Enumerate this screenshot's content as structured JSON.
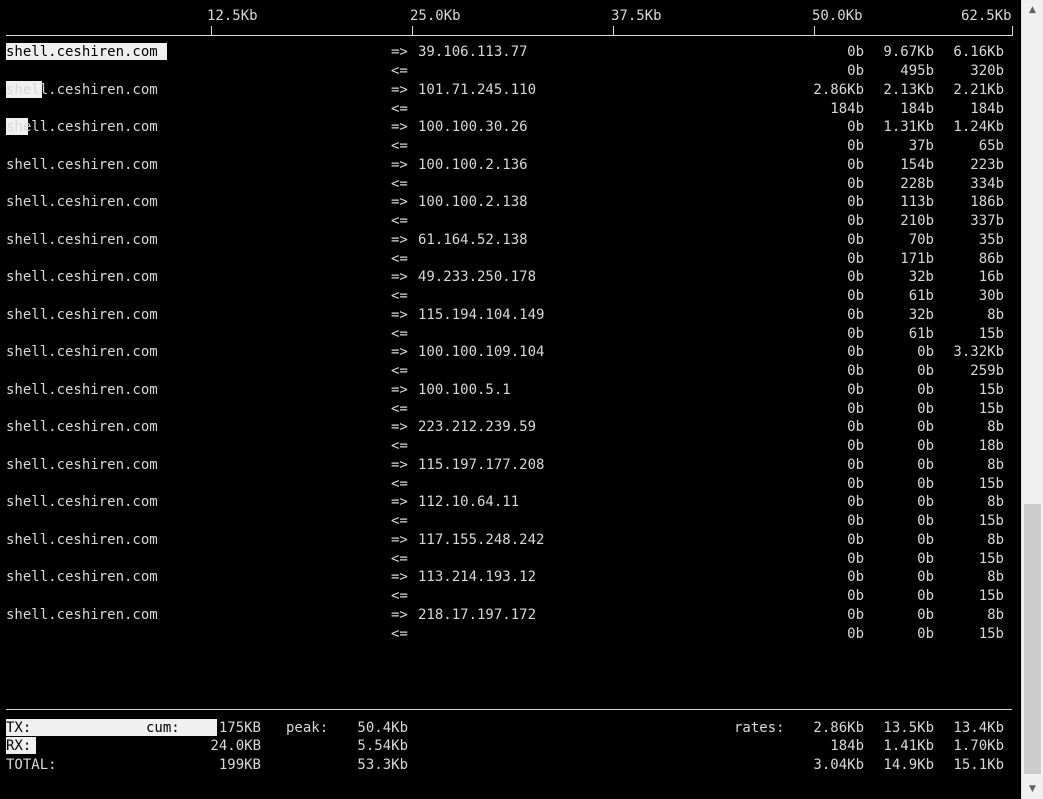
{
  "scale": {
    "labels": [
      "12.5Kb",
      "25.0Kb",
      "37.5Kb",
      "50.0Kb",
      "62.5Kb"
    ]
  },
  "connections": [
    {
      "host": "shell.ceshiren.com",
      "arrow_out": "=>",
      "arrow_in": "<=",
      "remote": "39.106.113.77",
      "out": [
        "0b",
        "9.67Kb",
        "6.16Kb"
      ],
      "in": [
        "0b",
        "495b",
        "320b"
      ],
      "bar_percent": 16
    },
    {
      "host": "shell.ceshiren.com",
      "arrow_out": "=>",
      "arrow_in": "<=",
      "remote": "101.71.245.110",
      "out": [
        "2.86Kb",
        "2.13Kb",
        "2.21Kb"
      ],
      "in": [
        "184b",
        "184b",
        "184b"
      ],
      "bar_percent": 3.6
    },
    {
      "host": "shell.ceshiren.com",
      "arrow_out": "=>",
      "arrow_in": "<=",
      "remote": "100.100.30.26",
      "out": [
        "0b",
        "1.31Kb",
        "1.24Kb"
      ],
      "in": [
        "0b",
        "37b",
        "65b"
      ],
      "bar_percent": 2.2
    },
    {
      "host": "shell.ceshiren.com",
      "arrow_out": "=>",
      "arrow_in": "<=",
      "remote": "100.100.2.136",
      "out": [
        "0b",
        "154b",
        "223b"
      ],
      "in": [
        "0b",
        "228b",
        "334b"
      ],
      "bar_percent": 0
    },
    {
      "host": "shell.ceshiren.com",
      "arrow_out": "=>",
      "arrow_in": "<=",
      "remote": "100.100.2.138",
      "out": [
        "0b",
        "113b",
        "186b"
      ],
      "in": [
        "0b",
        "210b",
        "337b"
      ],
      "bar_percent": 0
    },
    {
      "host": "shell.ceshiren.com",
      "arrow_out": "=>",
      "arrow_in": "<=",
      "remote": "61.164.52.138",
      "out": [
        "0b",
        "70b",
        "35b"
      ],
      "in": [
        "0b",
        "171b",
        "86b"
      ],
      "bar_percent": 0
    },
    {
      "host": "shell.ceshiren.com",
      "arrow_out": "=>",
      "arrow_in": "<=",
      "remote": "49.233.250.178",
      "out": [
        "0b",
        "32b",
        "16b"
      ],
      "in": [
        "0b",
        "61b",
        "30b"
      ],
      "bar_percent": 0
    },
    {
      "host": "shell.ceshiren.com",
      "arrow_out": "=>",
      "arrow_in": "<=",
      "remote": "115.194.104.149",
      "out": [
        "0b",
        "32b",
        "8b"
      ],
      "in": [
        "0b",
        "61b",
        "15b"
      ],
      "bar_percent": 0
    },
    {
      "host": "shell.ceshiren.com",
      "arrow_out": "=>",
      "arrow_in": "<=",
      "remote": "100.100.109.104",
      "out": [
        "0b",
        "0b",
        "3.32Kb"
      ],
      "in": [
        "0b",
        "0b",
        "259b"
      ],
      "bar_percent": 0
    },
    {
      "host": "shell.ceshiren.com",
      "arrow_out": "=>",
      "arrow_in": "<=",
      "remote": "100.100.5.1",
      "out": [
        "0b",
        "0b",
        "15b"
      ],
      "in": [
        "0b",
        "0b",
        "15b"
      ],
      "bar_percent": 0
    },
    {
      "host": "shell.ceshiren.com",
      "arrow_out": "=>",
      "arrow_in": "<=",
      "remote": "223.212.239.59",
      "out": [
        "0b",
        "0b",
        "8b"
      ],
      "in": [
        "0b",
        "0b",
        "18b"
      ],
      "bar_percent": 0
    },
    {
      "host": "shell.ceshiren.com",
      "arrow_out": "=>",
      "arrow_in": "<=",
      "remote": "115.197.177.208",
      "out": [
        "0b",
        "0b",
        "8b"
      ],
      "in": [
        "0b",
        "0b",
        "15b"
      ],
      "bar_percent": 0
    },
    {
      "host": "shell.ceshiren.com",
      "arrow_out": "=>",
      "arrow_in": "<=",
      "remote": "112.10.64.11",
      "out": [
        "0b",
        "0b",
        "8b"
      ],
      "in": [
        "0b",
        "0b",
        "15b"
      ],
      "bar_percent": 0
    },
    {
      "host": "shell.ceshiren.com",
      "arrow_out": "=>",
      "arrow_in": "<=",
      "remote": "117.155.248.242",
      "out": [
        "0b",
        "0b",
        "8b"
      ],
      "in": [
        "0b",
        "0b",
        "15b"
      ],
      "bar_percent": 0
    },
    {
      "host": "shell.ceshiren.com",
      "arrow_out": "=>",
      "arrow_in": "<=",
      "remote": "113.214.193.12",
      "out": [
        "0b",
        "0b",
        "8b"
      ],
      "in": [
        "0b",
        "0b",
        "15b"
      ],
      "bar_percent": 0
    },
    {
      "host": "shell.ceshiren.com",
      "arrow_out": "=>",
      "arrow_in": "<=",
      "remote": "218.17.197.172",
      "out": [
        "0b",
        "0b",
        "8b"
      ],
      "in": [
        "0b",
        "0b",
        "15b"
      ],
      "bar_percent": 0
    }
  ],
  "totals": {
    "tx_label": "TX:",
    "rx_label": "RX:",
    "total_label": "TOTAL:",
    "cum_label": "cum:",
    "peak_label": "peak:",
    "rates_label": "rates:",
    "tx": {
      "cum": "175KB",
      "peak": "50.4Kb",
      "rates": [
        "2.86Kb",
        "13.5Kb",
        "13.4Kb"
      ],
      "bar_percent": 21
    },
    "rx": {
      "cum": "24.0KB",
      "peak": "5.54Kb",
      "rates": [
        "184b",
        "1.41Kb",
        "1.70Kb"
      ],
      "bar_percent": 3
    },
    "total": {
      "cum": "199KB",
      "peak": "53.3Kb",
      "rates": [
        "3.04Kb",
        "14.9Kb",
        "15.1Kb"
      ]
    }
  },
  "scrollbar": {
    "up_icon": "▲",
    "down_icon": "▼"
  }
}
